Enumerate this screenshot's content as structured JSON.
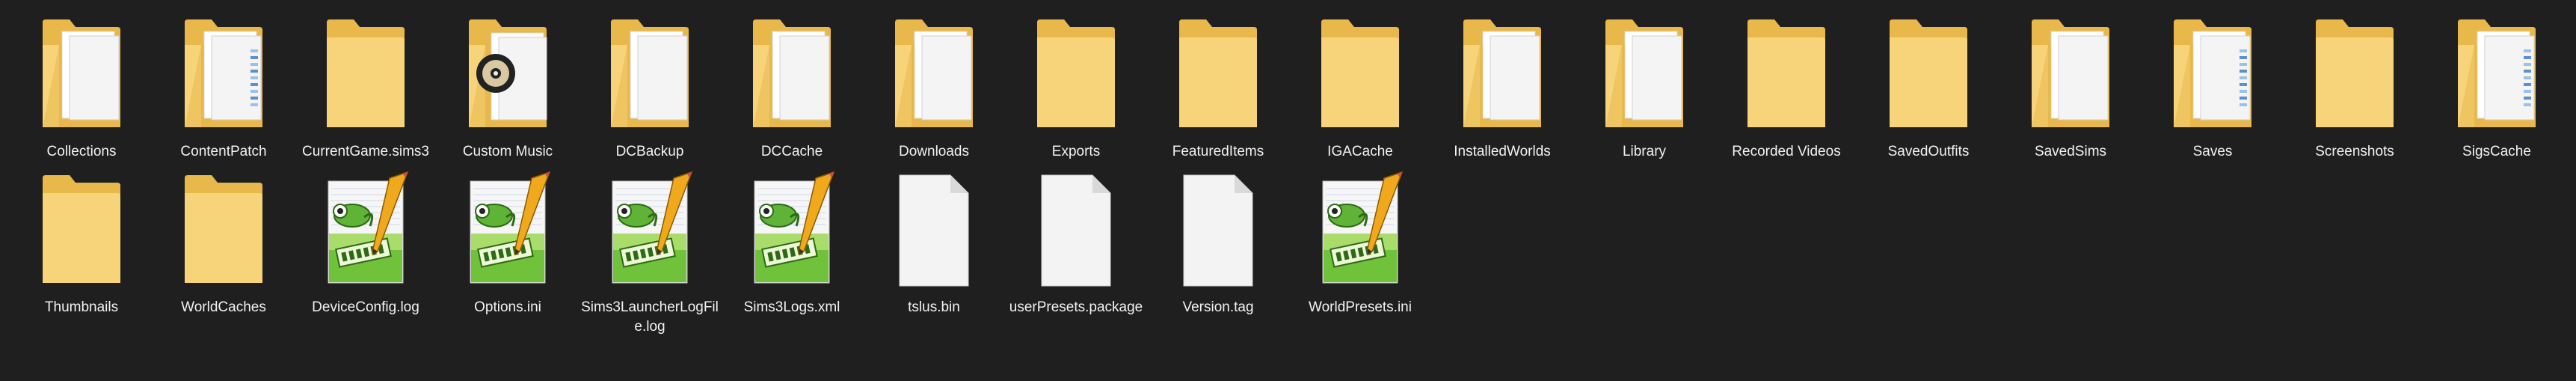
{
  "explorer": {
    "items": [
      {
        "name": "Collections",
        "type": "folder-with-docs"
      },
      {
        "name": "ContentPatch",
        "type": "folder-with-blue-docs"
      },
      {
        "name": "CurrentGame.sims3",
        "type": "folder-empty"
      },
      {
        "name": "Custom Music",
        "type": "folder-with-music"
      },
      {
        "name": "DCBackup",
        "type": "folder-with-docs"
      },
      {
        "name": "DCCache",
        "type": "folder-with-docs"
      },
      {
        "name": "Downloads",
        "type": "folder-with-docs"
      },
      {
        "name": "Exports",
        "type": "folder-empty"
      },
      {
        "name": "FeaturedItems",
        "type": "folder-empty"
      },
      {
        "name": "IGACache",
        "type": "folder-empty"
      },
      {
        "name": "InstalledWorlds",
        "type": "folder-with-docs"
      },
      {
        "name": "Library",
        "type": "folder-with-docs"
      },
      {
        "name": "Recorded Videos",
        "type": "folder-empty"
      },
      {
        "name": "SavedOutfits",
        "type": "folder-empty"
      },
      {
        "name": "SavedSims",
        "type": "folder-with-docs"
      },
      {
        "name": "Saves",
        "type": "folder-with-blue-docs"
      },
      {
        "name": "Screenshots",
        "type": "folder-empty"
      },
      {
        "name": "SigsCache",
        "type": "folder-with-blue-docs"
      },
      {
        "name": "Thumbnails",
        "type": "folder-empty"
      },
      {
        "name": "WorldCaches",
        "type": "folder-empty"
      },
      {
        "name": "DeviceConfig.log",
        "type": "notepadpp"
      },
      {
        "name": "Options.ini",
        "type": "notepadpp"
      },
      {
        "name": "Sims3LauncherLogFile.log",
        "type": "notepadpp"
      },
      {
        "name": "Sims3Logs.xml",
        "type": "notepadpp"
      },
      {
        "name": "tslus.bin",
        "type": "blank-file"
      },
      {
        "name": "userPresets.package",
        "type": "blank-file"
      },
      {
        "name": "Version.tag",
        "type": "blank-file"
      },
      {
        "name": "WorldPresets.ini",
        "type": "notepadpp"
      }
    ]
  },
  "colors": {
    "background": "#1f1f1f",
    "folder_back": "#e8b84a",
    "folder_front": "#f7d37a",
    "folder_front_light": "#fbe39a",
    "text": "#f2f2f2"
  }
}
